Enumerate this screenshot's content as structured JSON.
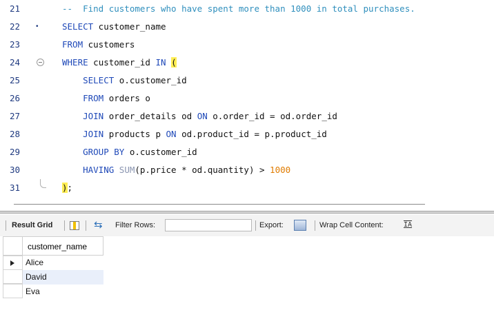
{
  "editor": {
    "lines": [
      {
        "num": "21",
        "parts": [
          {
            "t": "--  Find customers who have spent more than 1000 in total purchases.",
            "c": "cm"
          }
        ]
      },
      {
        "num": "22",
        "marker": "•",
        "parts": [
          {
            "t": "SELECT",
            "c": "kw"
          },
          {
            "t": " customer_name",
            "c": ""
          }
        ]
      },
      {
        "num": "23",
        "parts": [
          {
            "t": "FROM",
            "c": "kw"
          },
          {
            "t": " customers",
            "c": ""
          }
        ]
      },
      {
        "num": "24",
        "fold": true,
        "parts": [
          {
            "t": "WHERE",
            "c": "kw"
          },
          {
            "t": " customer_id ",
            "c": ""
          },
          {
            "t": "IN",
            "c": "kw"
          },
          {
            "t": " ",
            "c": ""
          },
          {
            "t": "(",
            "c": "paren"
          }
        ]
      },
      {
        "num": "25",
        "parts": [
          {
            "t": "    ",
            "c": ""
          },
          {
            "t": "SELECT",
            "c": "kw"
          },
          {
            "t": " o.customer_id",
            "c": ""
          }
        ]
      },
      {
        "num": "26",
        "parts": [
          {
            "t": "    ",
            "c": ""
          },
          {
            "t": "FROM",
            "c": "kw"
          },
          {
            "t": " orders o",
            "c": ""
          }
        ]
      },
      {
        "num": "27",
        "parts": [
          {
            "t": "    ",
            "c": ""
          },
          {
            "t": "JOIN",
            "c": "kw"
          },
          {
            "t": " order_details od ",
            "c": ""
          },
          {
            "t": "ON",
            "c": "kw"
          },
          {
            "t": " o.order_id = od.order_id",
            "c": ""
          }
        ]
      },
      {
        "num": "28",
        "parts": [
          {
            "t": "    ",
            "c": ""
          },
          {
            "t": "JOIN",
            "c": "kw"
          },
          {
            "t": " products p ",
            "c": ""
          },
          {
            "t": "ON",
            "c": "kw"
          },
          {
            "t": " od.product_id = p.product_id",
            "c": ""
          }
        ]
      },
      {
        "num": "29",
        "parts": [
          {
            "t": "    ",
            "c": ""
          },
          {
            "t": "GROUP BY",
            "c": "kw"
          },
          {
            "t": " o.customer_id",
            "c": ""
          }
        ]
      },
      {
        "num": "30",
        "parts": [
          {
            "t": "    ",
            "c": ""
          },
          {
            "t": "HAVING",
            "c": "kw"
          },
          {
            "t": " ",
            "c": ""
          },
          {
            "t": "SUM",
            "c": "fn"
          },
          {
            "t": "(p.price * od.quantity) > ",
            "c": ""
          },
          {
            "t": "1000",
            "c": "num"
          }
        ]
      },
      {
        "num": "31",
        "foldEnd": true,
        "parts": [
          {
            "t": ")",
            "c": "paren"
          },
          {
            "t": ";",
            "c": ""
          }
        ]
      }
    ]
  },
  "toolbar": {
    "result_grid": "Result Grid",
    "filter_rows": "Filter Rows:",
    "filter_value": "",
    "export": "Export:",
    "wrap": "Wrap Cell Content:",
    "wrap_icon_glyph": "IA"
  },
  "grid": {
    "column": "customer_name",
    "rows": [
      "Alice",
      "David",
      "Eva"
    ],
    "selected_row": 0,
    "hover_row": 1
  },
  "colors": {
    "keyword": "#1f49b8",
    "comment": "#2f8fbd",
    "number": "#e07b00",
    "paren_highlight": "#ffee55",
    "hover_row": "#e9effa"
  }
}
